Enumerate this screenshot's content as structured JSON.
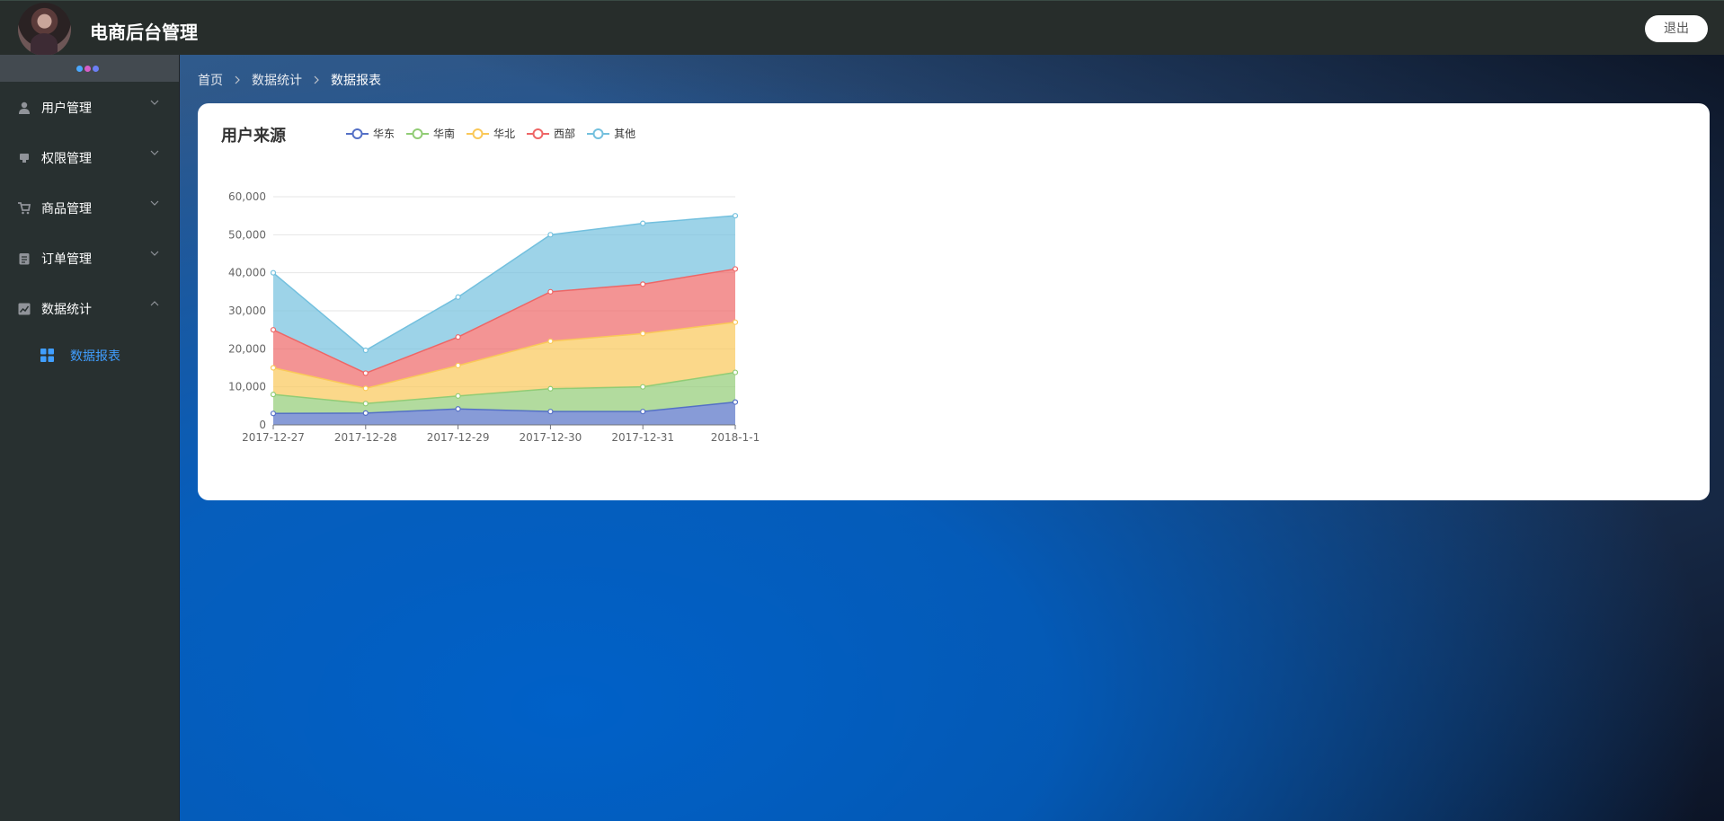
{
  "header": {
    "title": "电商后台管理",
    "logout_label": "退出"
  },
  "sidebar": {
    "toggle_dot_colors": [
      "#4aa8ff",
      "#d65ec8",
      "#6b7ff5"
    ],
    "items": [
      {
        "label": "用户管理",
        "icon": "user-icon"
      },
      {
        "label": "权限管理",
        "icon": "permission-icon"
      },
      {
        "label": "商品管理",
        "icon": "cart-icon"
      },
      {
        "label": "订单管理",
        "icon": "order-icon"
      },
      {
        "label": "数据统计",
        "icon": "stats-icon",
        "expanded": true,
        "children": [
          {
            "label": "数据报表",
            "icon": "grid-icon",
            "active": true
          }
        ]
      }
    ]
  },
  "breadcrumb": {
    "home": "首页",
    "section": "数据统计",
    "current": "数据报表"
  },
  "report": {
    "title": "用户来源"
  },
  "chart_data": {
    "type": "area",
    "stacked": true,
    "title": "用户来源",
    "x": [
      "2017-12-27",
      "2017-12-28",
      "2017-12-29",
      "2017-12-30",
      "2017-12-31",
      "2018-1-1"
    ],
    "ylim": [
      0,
      60000
    ],
    "yticks": [
      "0",
      "10,000",
      "20,000",
      "30,000",
      "40,000",
      "50,000",
      "60,000"
    ],
    "grid": true,
    "legend_position": "top",
    "series": [
      {
        "name": "华东",
        "color": "#5470c6",
        "values": [
          3000,
          3100,
          4200,
          3500,
          3500,
          6000
        ]
      },
      {
        "name": "华南",
        "color": "#91cc75",
        "values": [
          5000,
          2500,
          3400,
          6000,
          6500,
          7800
        ]
      },
      {
        "name": "华北",
        "color": "#fac858",
        "values": [
          7000,
          4000,
          8000,
          12500,
          14000,
          13200
        ]
      },
      {
        "name": "西部",
        "color": "#ee6666",
        "values": [
          10000,
          4000,
          7500,
          13000,
          13000,
          14000
        ]
      },
      {
        "name": "其他",
        "color": "#73c0de",
        "values": [
          15000,
          6000,
          10500,
          15000,
          16000,
          14000
        ]
      }
    ]
  }
}
